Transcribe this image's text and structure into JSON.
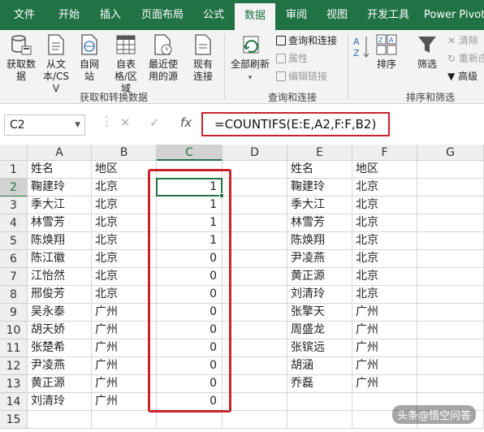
{
  "ribbon_tabs": [
    "文件",
    "开始",
    "插入",
    "页面布局",
    "公式",
    "数据",
    "审阅",
    "视图",
    "开发工具",
    "Power Pivot"
  ],
  "active_tab": "数据",
  "ribbon": {
    "get_data": "获取数据",
    "from_text": "从文本/CSV",
    "from_web": "自网站",
    "from_table": "自表格/区域",
    "recent_sources": "最近使用的源",
    "existing_connections": "现有连接",
    "group_get_transform": "获取和转换数据",
    "refresh_all": "全部刷新",
    "queries_connections": "查询和连接",
    "properties": "属性",
    "edit_links": "编辑链接",
    "group_queries": "查询和连接",
    "sort": "排序",
    "filter": "筛选",
    "clear": "清除",
    "reapply": "重新应用",
    "advanced": "高级",
    "group_sort_filter": "排序和筛选"
  },
  "name_box": "C2",
  "formula": "=COUNTIFS(E:E,A2,F:F,B2)",
  "columns": [
    "A",
    "B",
    "C",
    "D",
    "E",
    "F",
    "G"
  ],
  "rows": [
    {
      "n": "1",
      "A": "姓名",
      "B": "地区",
      "C": "",
      "E": "姓名",
      "F": "地区"
    },
    {
      "n": "2",
      "A": "鞠建玲",
      "B": "北京",
      "C": "1",
      "E": "鞠建玲",
      "F": "北京"
    },
    {
      "n": "3",
      "A": "季大江",
      "B": "北京",
      "C": "1",
      "E": "季大江",
      "F": "北京"
    },
    {
      "n": "4",
      "A": "林雪芳",
      "B": "北京",
      "C": "1",
      "E": "林雪芳",
      "F": "北京"
    },
    {
      "n": "5",
      "A": "陈焕翔",
      "B": "北京",
      "C": "1",
      "E": "陈焕翔",
      "F": "北京"
    },
    {
      "n": "6",
      "A": "陈江徽",
      "B": "北京",
      "C": "0",
      "E": "尹凌燕",
      "F": "北京"
    },
    {
      "n": "7",
      "A": "江怡然",
      "B": "北京",
      "C": "0",
      "E": "黄正源",
      "F": "北京"
    },
    {
      "n": "8",
      "A": "邢俊芳",
      "B": "北京",
      "C": "0",
      "E": "刘清玲",
      "F": "北京"
    },
    {
      "n": "9",
      "A": "吴永泰",
      "B": "广州",
      "C": "0",
      "E": "张擎天",
      "F": "广州"
    },
    {
      "n": "10",
      "A": "胡天娇",
      "B": "广州",
      "C": "0",
      "E": "周盛龙",
      "F": "广州"
    },
    {
      "n": "11",
      "A": "张楚希",
      "B": "广州",
      "C": "0",
      "E": "张镔远",
      "F": "广州"
    },
    {
      "n": "12",
      "A": "尹凌燕",
      "B": "广州",
      "C": "0",
      "E": "胡涵",
      "F": "广州"
    },
    {
      "n": "13",
      "A": "黄正源",
      "B": "广州",
      "C": "0",
      "E": "乔磊",
      "F": "广州"
    },
    {
      "n": "14",
      "A": "刘清玲",
      "B": "广州",
      "C": "0",
      "E": "",
      "F": ""
    },
    {
      "n": "15",
      "A": "",
      "B": "",
      "C": "",
      "E": "",
      "F": ""
    }
  ],
  "watermark": "头条@悟空问答",
  "colors": {
    "excel_green": "#217346",
    "highlight_red": "#c9242b"
  }
}
